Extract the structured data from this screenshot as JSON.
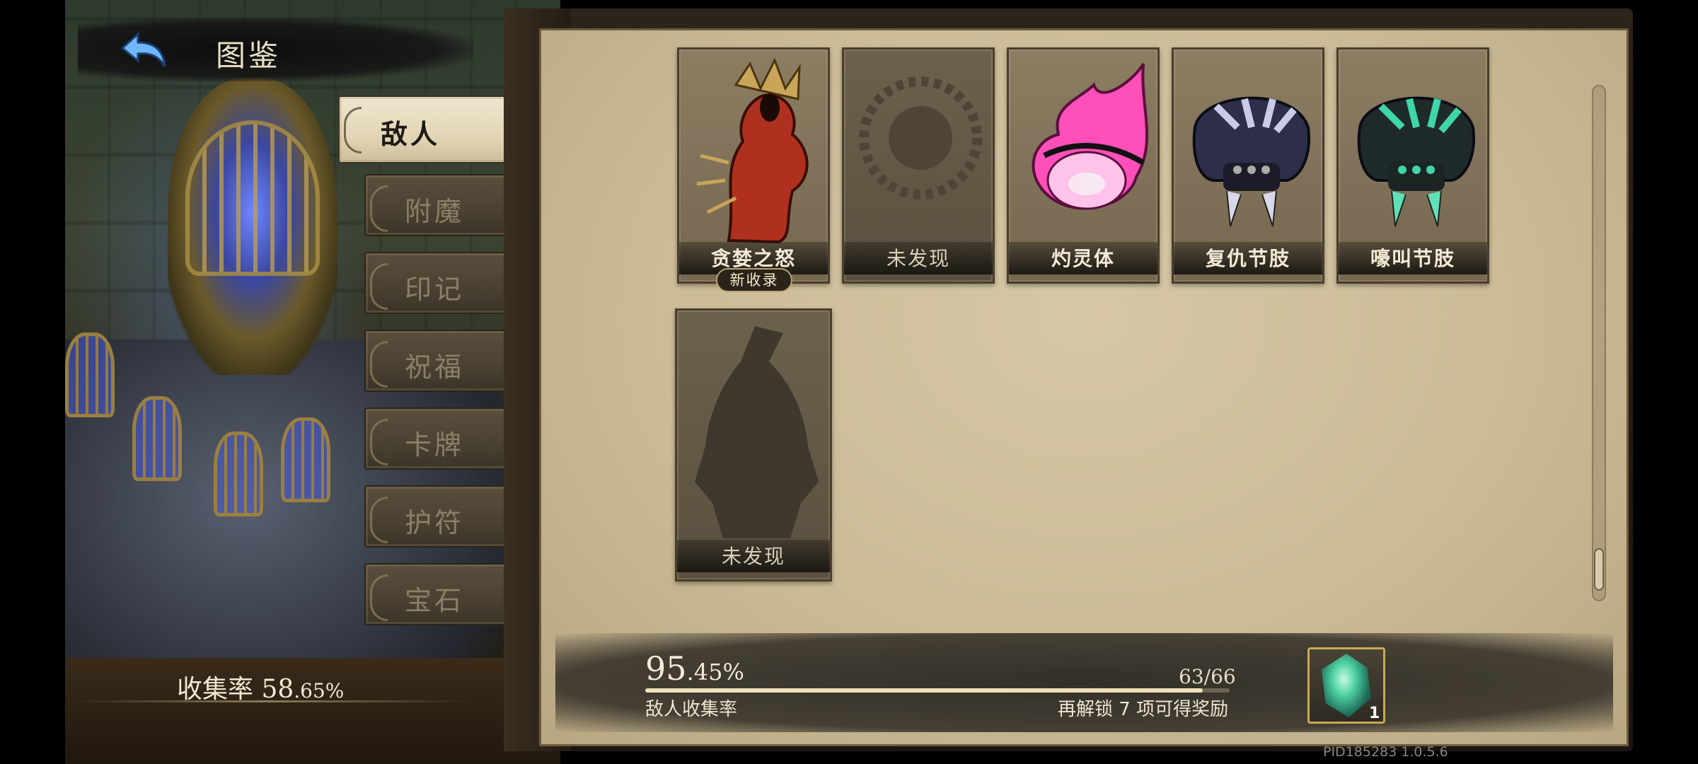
{
  "header": {
    "title": "图鉴"
  },
  "tabs": [
    {
      "label": "敌人",
      "active": true
    },
    {
      "label": "附魔",
      "active": false
    },
    {
      "label": "印记",
      "active": false
    },
    {
      "label": "祝福",
      "active": false
    },
    {
      "label": "卡牌",
      "active": false
    },
    {
      "label": "护符",
      "active": false
    },
    {
      "label": "宝石",
      "active": false
    }
  ],
  "collection": {
    "label": "收集率",
    "whole": "58",
    "fraction": ".65%"
  },
  "cards": [
    {
      "name": "贪婪之怒",
      "discovered": true,
      "badge": "新收录",
      "icon": "red-demon-icon"
    },
    {
      "name": "未发现",
      "discovered": false,
      "icon": "unknown-silhouette-icon"
    },
    {
      "name": "灼灵体",
      "discovered": true,
      "icon": "pink-flame-spirit-icon"
    },
    {
      "name": "复仇节肢",
      "discovered": true,
      "icon": "dark-spider-icon"
    },
    {
      "name": "嚎叫节肢",
      "discovered": true,
      "icon": "green-spider-icon"
    },
    {
      "name": "未发现",
      "discovered": false,
      "icon": "unknown-silhouette-icon"
    }
  ],
  "progress": {
    "whole": "95",
    "fraction": ".45%",
    "count": "63/66",
    "fill_fraction": 0.9545,
    "label": "敌人收集率",
    "reward_text": "再解锁 7 项可得奖励",
    "reward_qty": "1",
    "reward_icon": "green-crystal-icon"
  },
  "version": "PID185283  1.0.5.6",
  "colors": {
    "paper": "#cbbb97",
    "frame": "#2c241a",
    "accent": "#efe2b8",
    "pink_flame": "#ff4fb8",
    "teal": "#3fd6a8"
  }
}
